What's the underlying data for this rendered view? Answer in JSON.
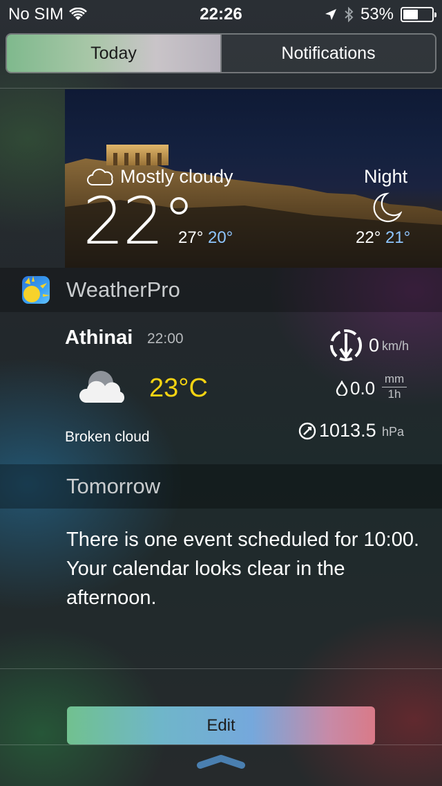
{
  "status_bar": {
    "carrier": "No SIM",
    "time": "22:26",
    "battery": "53%",
    "battery_level": 0.53
  },
  "tabs": [
    {
      "label": "Today",
      "selected": true
    },
    {
      "label": "Notifications",
      "selected": false
    }
  ],
  "weather_hero": {
    "condition": "Mostly cloudy",
    "temperature": "22°",
    "high": "27°",
    "low": "20°",
    "night_label": "Night",
    "night_high": "22°",
    "night_low": "21°"
  },
  "app": {
    "name": "WeatherPro"
  },
  "current": {
    "city": "Athinai",
    "time": "22:00",
    "temperature": "23°C",
    "condition": "Broken cloud",
    "wind_value": "0",
    "wind_unit": "km/h",
    "rain_value": "0.0",
    "rain_unit_top": "mm",
    "rain_unit_bottom": "1h",
    "pressure_value": "1013.5",
    "pressure_unit": "hPa"
  },
  "tomorrow": {
    "label": "Tomorrow",
    "summary": "There is one event scheduled for 10:00. Your calendar looks clear in the afternoon."
  },
  "footer": {
    "edit_label": "Edit"
  },
  "colors": {
    "temp_yellow": "#f5d312",
    "low_blue": "#8fc6ff"
  }
}
